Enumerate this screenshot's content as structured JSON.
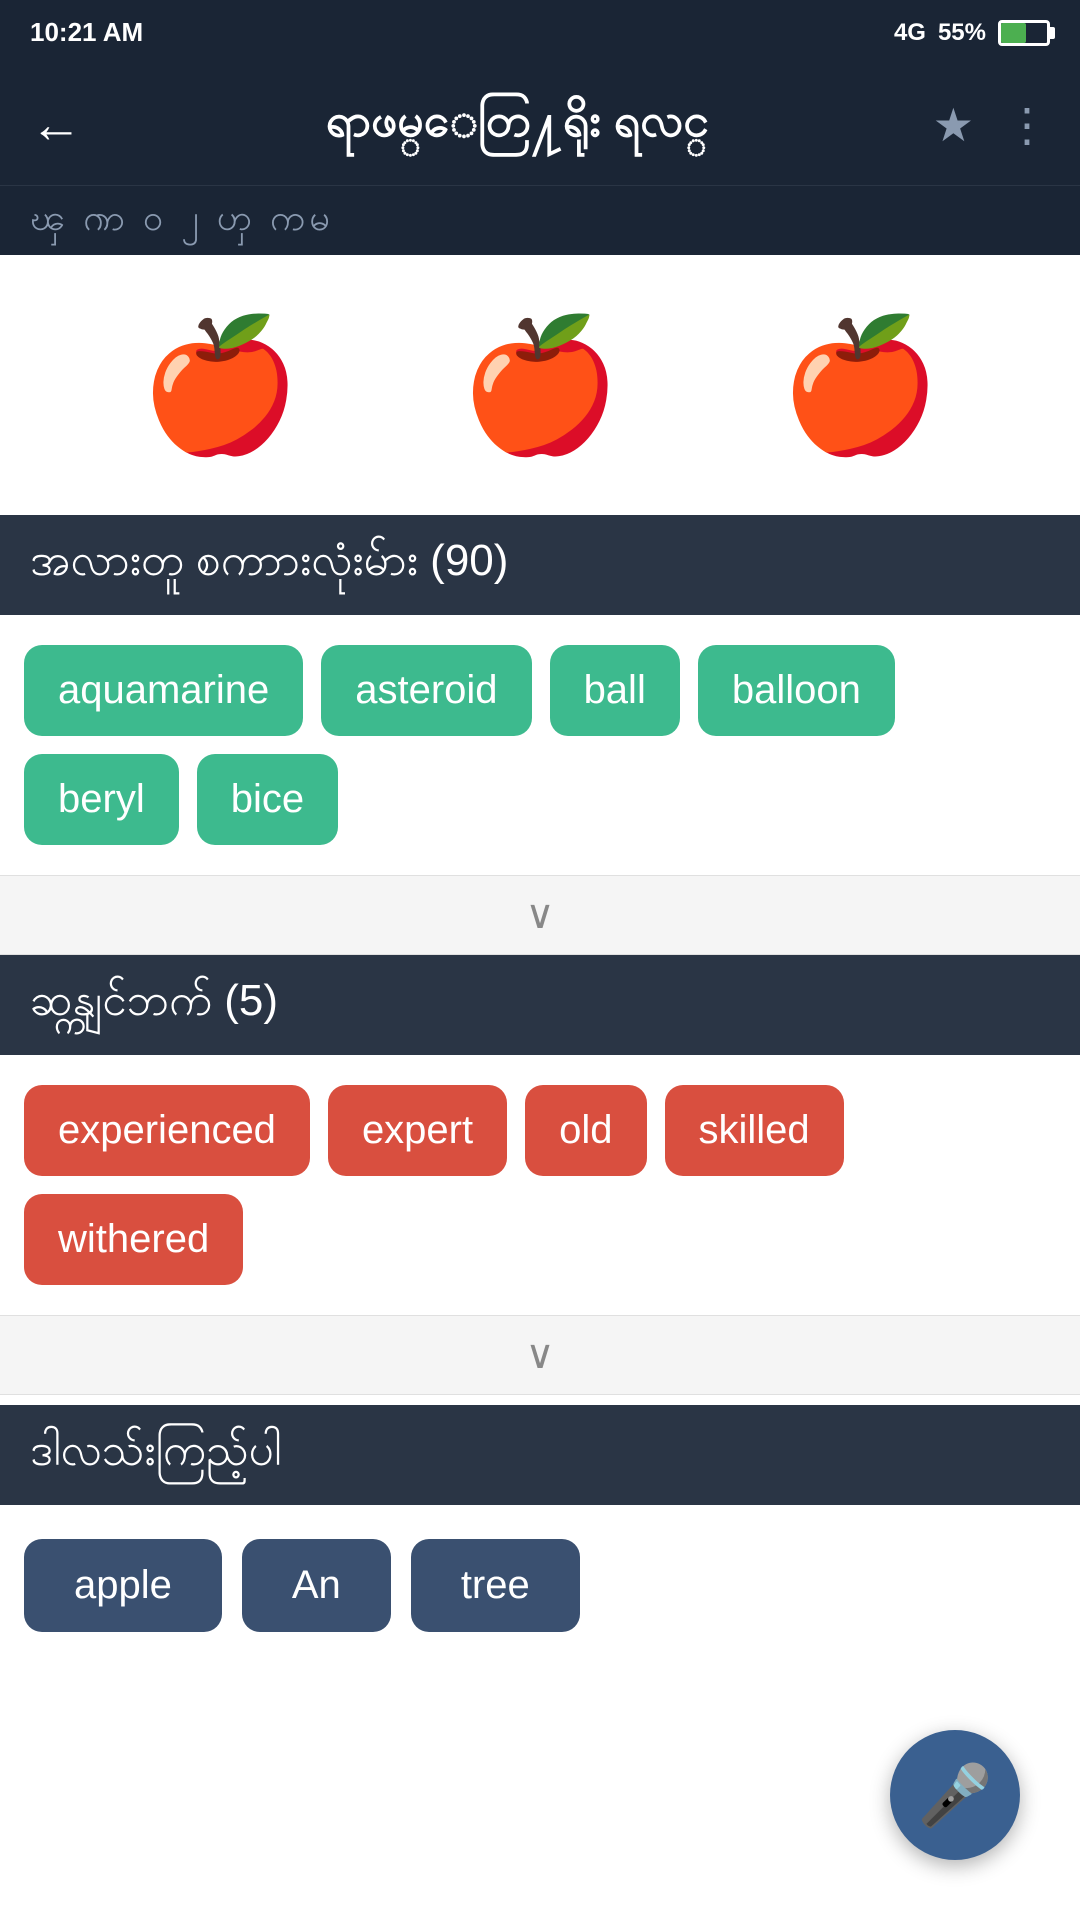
{
  "status": {
    "time": "10:21 AM",
    "signal": "4G",
    "battery": "55%"
  },
  "nav": {
    "title": "ရာဖမ္ေတြ႔ရိုး ရလင္",
    "back_label": "←",
    "star_icon": "★",
    "more_icon": "⋮",
    "tab_text": "ၾ  ၮ  ဝ  ၂  ၯ       ကမ"
  },
  "apple_icons": [
    "🍎",
    "🍎",
    "🍎"
  ],
  "section1": {
    "title": "အလားတူ စကာားလုံးမ်ား (90)",
    "tags": [
      "aquamarine",
      "asteroid",
      "ball",
      "balloon",
      "beryl",
      "bice"
    ],
    "tag_color": "green"
  },
  "expand1": {
    "icon": "∨"
  },
  "section2": {
    "title": "ဆန္ကျင်ဘက် (5)",
    "tags": [
      "experienced",
      "expert",
      "old",
      "skilled",
      "withered"
    ],
    "tag_color": "red"
  },
  "expand2": {
    "icon": "∨"
  },
  "section3": {
    "title": "ဒါလသ်းကြည့်ပါ"
  },
  "bottom_pills": [
    "apple",
    "An",
    "tree"
  ],
  "mic_label": "🎤"
}
